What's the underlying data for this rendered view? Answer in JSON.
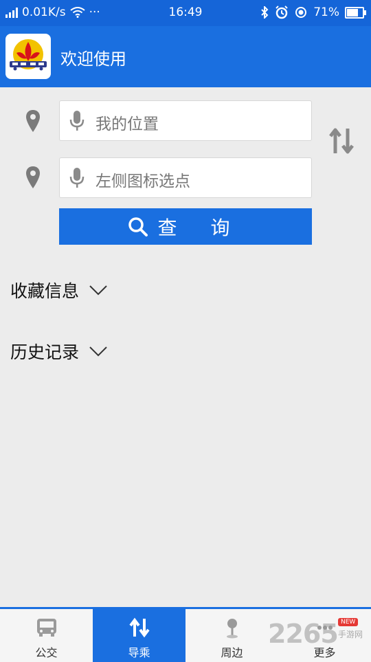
{
  "status_bar": {
    "speed": "0.01K/s",
    "dots": "···",
    "time": "16:49",
    "battery_text": "71%",
    "battery_level": 0.71
  },
  "header": {
    "title": "欢迎使用",
    "logo_icon": "bus-company-logo"
  },
  "route": {
    "origin_placeholder": "我的位置",
    "destination_placeholder": "左侧图标选点",
    "search_label": "查 询"
  },
  "sections": {
    "favorites": "收藏信息",
    "history": "历史记录"
  },
  "bottom_nav": {
    "items": [
      {
        "label": "公交",
        "icon": "bus-icon"
      },
      {
        "label": "导乘",
        "icon": "route-swap-icon"
      },
      {
        "label": "周边",
        "icon": "nearby-pin-icon"
      },
      {
        "label": "更多",
        "icon": "more-icon"
      }
    ],
    "active": "导乘",
    "new_badge": "NEW"
  },
  "watermark": {
    "main": "2265",
    "sub": "手游网"
  },
  "colors": {
    "primary": "#1a6fe0",
    "status_bar": "#1565d8",
    "background": "#ececec"
  }
}
